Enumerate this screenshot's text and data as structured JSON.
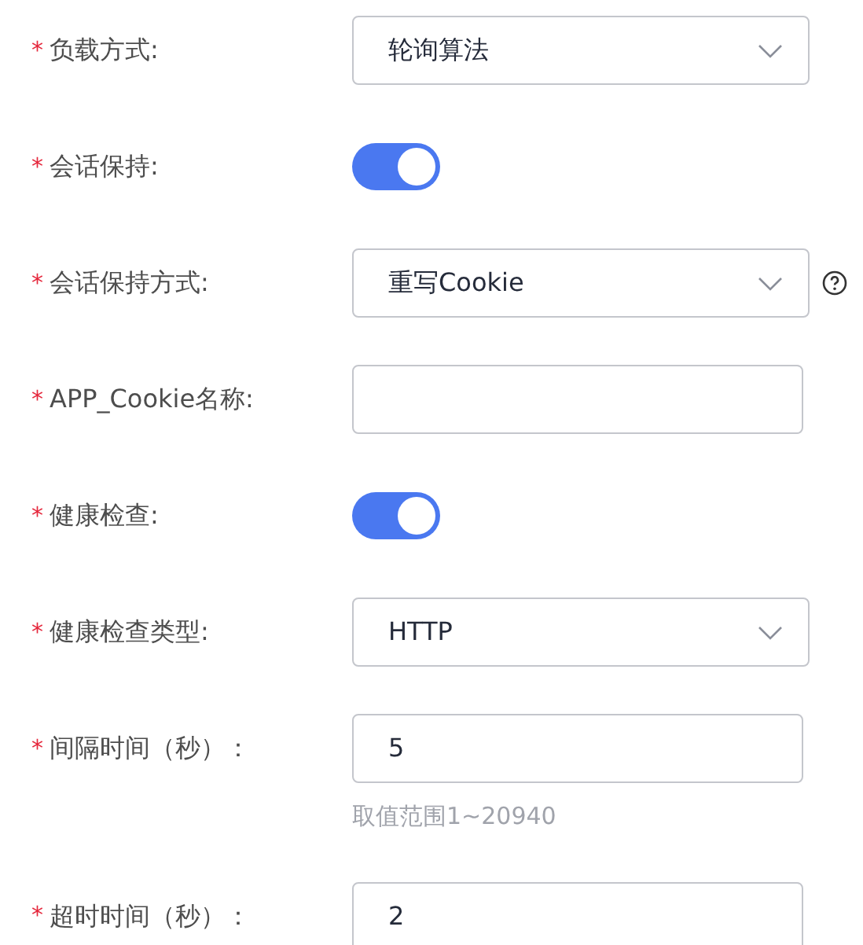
{
  "fields": [
    {
      "kind": "select",
      "mark": "*",
      "label": "负载方式:",
      "value": "轮询算法"
    },
    {
      "kind": "switch",
      "mark": "*",
      "label": "会话保持:",
      "on": true
    },
    {
      "kind": "select",
      "mark": "*",
      "label": "会话保持方式:",
      "value": "重写Cookie",
      "help": true
    },
    {
      "kind": "input",
      "mark": "*",
      "label": "APP_Cookie名称:"
    },
    {
      "kind": "switch",
      "mark": "*",
      "label": "健康检查:",
      "on": true
    },
    {
      "kind": "select",
      "mark": "*",
      "label": "健康检查类型:",
      "value": "HTTP"
    },
    {
      "kind": "input",
      "mark": "*",
      "label": "间隔时间（秒）：",
      "value": "5",
      "hint": "取值范围1~20940"
    },
    {
      "kind": "input",
      "mark": "*",
      "label": "超时时间（秒）：",
      "value": "2"
    }
  ]
}
